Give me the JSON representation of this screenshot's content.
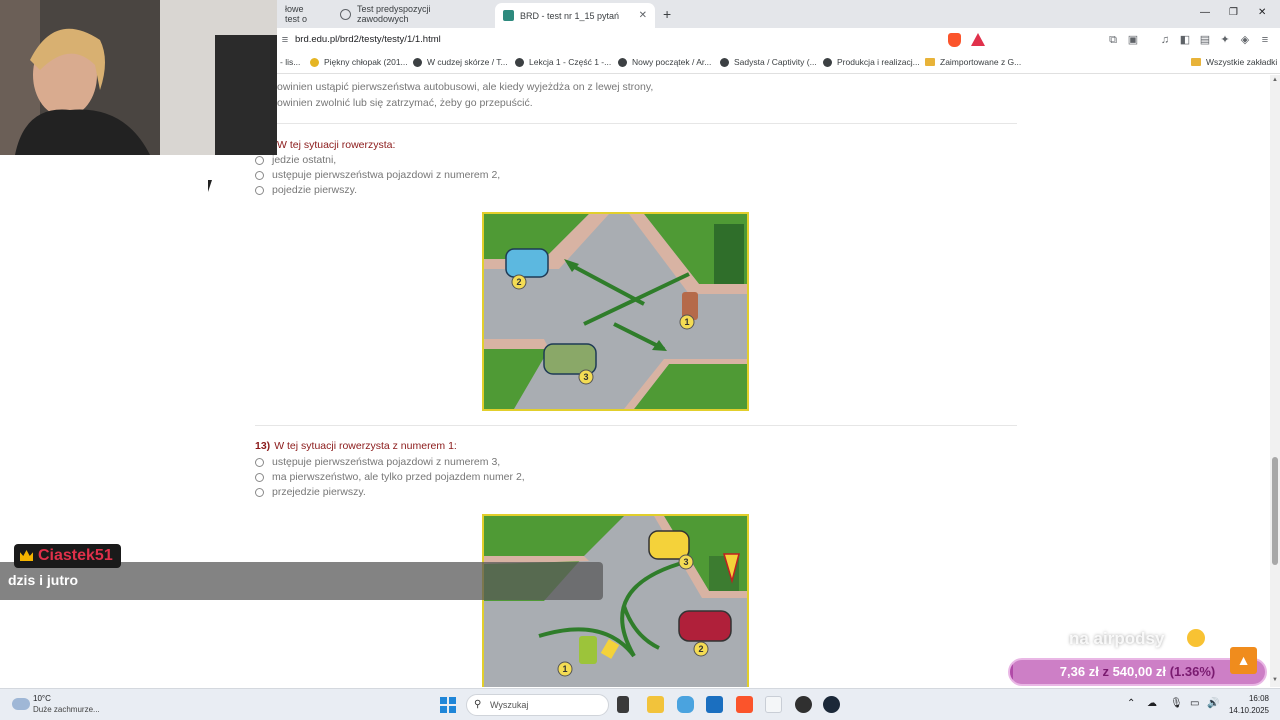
{
  "browser": {
    "tabs": [
      {
        "label": "łowe test o"
      },
      {
        "label": "Test predyspozycji zawodowych"
      },
      {
        "label": "BRD - test nr 1_15 pytań",
        "active": true
      }
    ],
    "new_tab_symbol": "+",
    "tab_close_symbol": "✕",
    "window_controls": [
      "—",
      "❐",
      "✕"
    ],
    "url": "brd.edu.pl/brd2/testy/testy/1/1.html",
    "bookmarks": [
      {
        "label": "- lis..."
      },
      {
        "label": "Piękny chłopak (201..."
      },
      {
        "label": "W cudzej skórze / T..."
      },
      {
        "label": "Lekcja 1 - Część 1 -..."
      },
      {
        "label": "Nowy początek / Ar..."
      },
      {
        "label": "Sadysta / Captivity (..."
      },
      {
        "label": "Produkcja i realizacj..."
      },
      {
        "label": "Zaimportowane z G..."
      }
    ],
    "all_bookmarks": "Wszystkie zakładki"
  },
  "page": {
    "prev_answers": [
      "owinien ustąpić pierwszeństwa autobusowi, ale kiedy wyjeżdża on z lewej strony,",
      "owinien zwolnić lub się zatrzymać, żeby go przepuścić."
    ],
    "q12": {
      "title": "W tej sytuacji rowerzysta:",
      "answers": [
        "jedzie ostatni,",
        "ustępuje pierwszeństwa pojazdowi z numerem 2,",
        "pojedzie pierwszy."
      ],
      "image_numbers": [
        "2",
        "1",
        "3"
      ]
    },
    "q13": {
      "number": "13)",
      "title": "W tej sytuacji rowerzysta z numerem 1:",
      "answers": [
        "ustępuje pierwszeństwa pojazdowi z numerem 3,",
        "ma pierwszeństwo, ale tylko przed pojazdem numer 2,",
        "przejedzie pierwszy."
      ],
      "image_numbers": [
        "3",
        "1",
        "2"
      ]
    }
  },
  "overlay": {
    "chat_user": "Ciastek51",
    "chat_message": "dzis i jutro",
    "donation_label": "na airpodsy",
    "donation": {
      "current": "7,36 zł",
      "connector": "z",
      "goal": "540,00 zł",
      "percent_text": "(1.36%)",
      "percent": 1.36
    },
    "scroll_top_symbol": "▲"
  },
  "taskbar": {
    "weather_temp": "10°C",
    "weather_desc": "Duże zachmurze...",
    "search_placeholder": "Wyszukaj",
    "time": "16:08",
    "date": "14.10.2025"
  },
  "colors": {
    "question_title": "#8b1a1a",
    "image_border": "#e2cf2c",
    "donation_bar": "#b14aa8",
    "chat_user": "#e0304a"
  }
}
